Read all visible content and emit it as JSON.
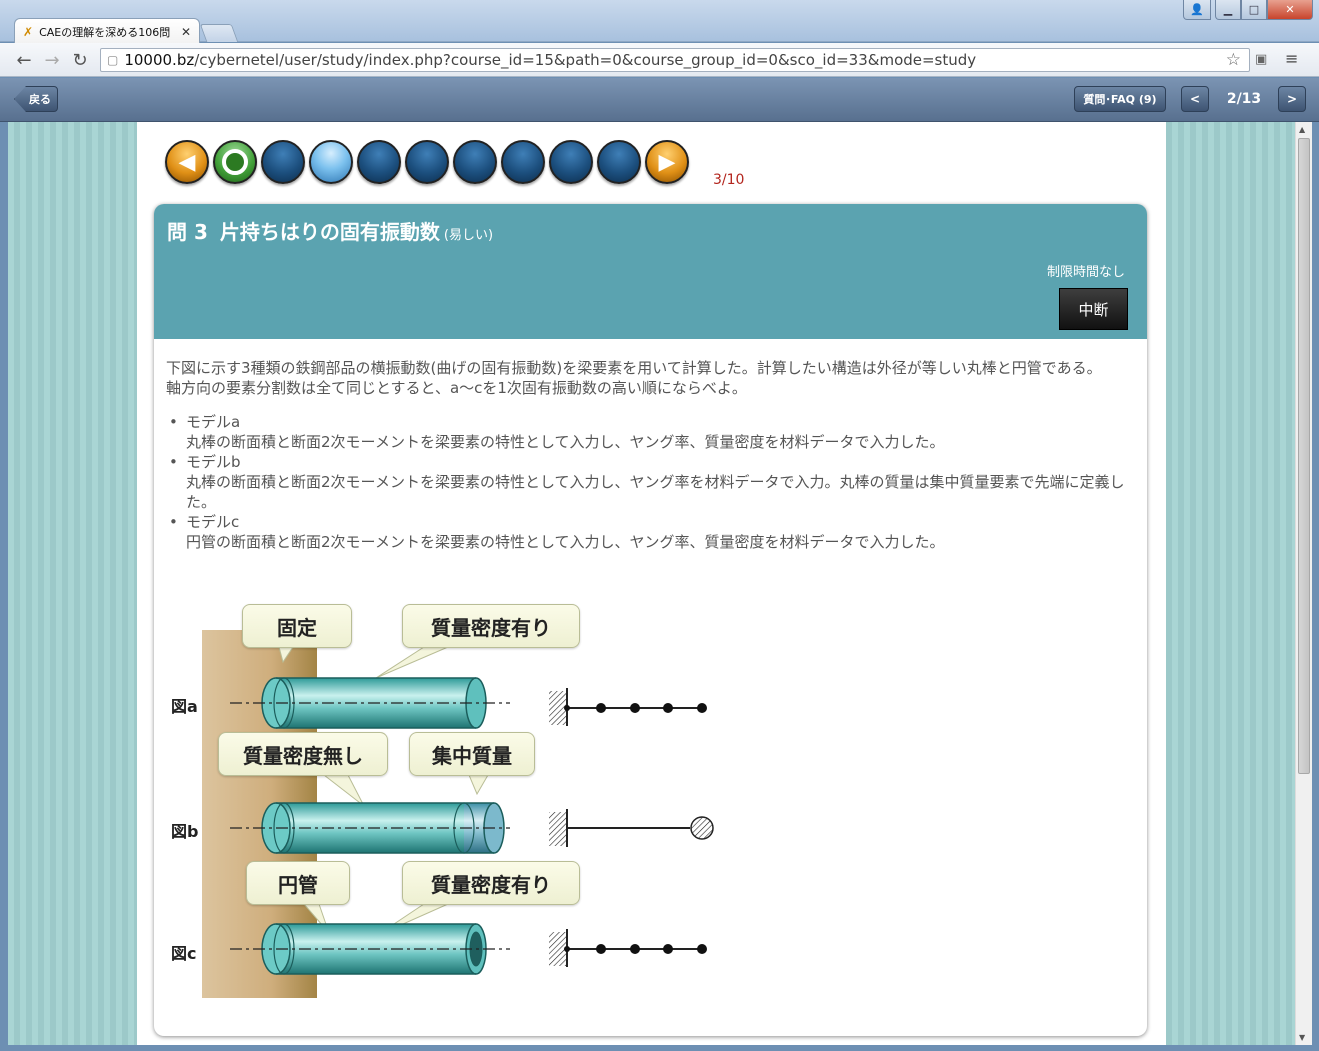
{
  "browser": {
    "tab_title": "CAEの理解を深める106問",
    "url_host": "10000.bz",
    "url_path": "/cybernetel/user/study/index.php?course_id=15&path=0&course_group_id=0&sco_id=33&mode=study"
  },
  "appbar": {
    "back_label": "戻る",
    "faq_label": "質問･FAQ (9)",
    "prev_label": "<",
    "next_label": ">",
    "page_counter": "2/13"
  },
  "progress": {
    "count": "3/10",
    "current_index": 3,
    "total": 10
  },
  "question": {
    "number": "問 3",
    "title": "片持ちはりの固有振動数",
    "difficulty": "(易しい)",
    "time_limit": "制限時間なし",
    "pause_label": "中断",
    "intro_1": "下図に示す3種類の鉄鋼部品の横振動数(曲げの固有振動数)を梁要素を用いて計算した。計算したい構造は外径が等しい丸棒と円管である。",
    "intro_2": "軸方向の要素分割数は全て同じとすると、a～cを1次固有振動数の高い順にならべよ。",
    "models": [
      {
        "name": "モデルa",
        "desc": "丸棒の断面積と断面2次モーメントを梁要素の特性として入力し、ヤング率、質量密度を材料データで入力した。"
      },
      {
        "name": "モデルb",
        "desc": "丸棒の断面積と断面2次モーメントを梁要素の特性として入力し、ヤング率を材料データで入力。丸棒の質量は集中質量要素で先端に定義した。"
      },
      {
        "name": "モデルc",
        "desc": "円管の断面積と断面2次モーメントを梁要素の特性として入力し、ヤング率、質量密度を材料データで入力した。"
      }
    ]
  },
  "figure": {
    "label_a": "図a",
    "label_b": "図b",
    "label_c": "図c",
    "bubble_fixed": "固定",
    "bubble_mass_yes_a": "質量密度有り",
    "bubble_mass_no": "質量密度無し",
    "bubble_lumped": "集中質量",
    "bubble_pipe": "円管",
    "bubble_mass_yes_c": "質量密度有り"
  },
  "colors": {
    "appbar": "#58708f",
    "card_header": "#5ba3b0",
    "counter_red": "#b3261e"
  }
}
